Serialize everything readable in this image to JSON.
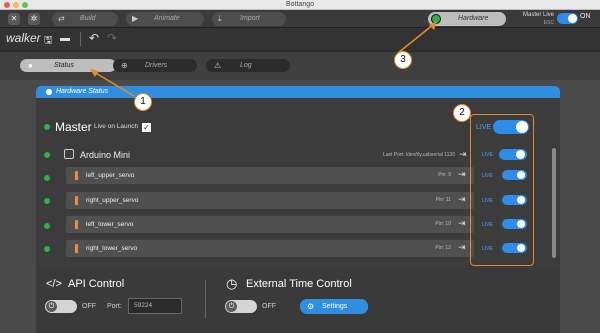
{
  "window": {
    "title": "Bottango"
  },
  "toolbar": {
    "build_label": "Build",
    "animate_label": "Animate",
    "import_label": "Import",
    "hardware_label": "Hardware",
    "master_live_label": "Master Live",
    "esc_hint": "ESC",
    "on_label": "ON"
  },
  "project": {
    "name": "walker"
  },
  "tabs": [
    {
      "label": "Status"
    },
    {
      "label": "Drivers"
    },
    {
      "label": "Log"
    }
  ],
  "panel": {
    "title": "Hardware Status",
    "master_label": "Master",
    "live_on_launch": "Live on Launch",
    "live_label": "LIVE",
    "driver": {
      "name": "Arduino Mini",
      "last_port": "Last Port: /dev/tty.usbserial 1130",
      "live_label": "LIVE"
    },
    "servos": [
      {
        "name": "left_upper_servo",
        "pin": "Pin: 9",
        "live": "LIVE"
      },
      {
        "name": "right_upper_servo",
        "pin": "Pin: 11",
        "live": "LIVE"
      },
      {
        "name": "left_lower_servo",
        "pin": "Pin: 10",
        "live": "LIVE"
      },
      {
        "name": "right_lower_servo",
        "pin": "Pin: 12",
        "live": "LIVE"
      }
    ]
  },
  "api_control": {
    "title": "API Control",
    "state": "OFF",
    "port_label": "Port:",
    "port_value": "59224"
  },
  "external_time": {
    "title": "External Time Control",
    "state": "OFF",
    "settings_label": "Settings"
  },
  "annotations": [
    "1",
    "2",
    "3"
  ],
  "colors": {
    "accent": "#2f8ee0",
    "live_green": "#2bb34a",
    "annotation": "#e38a2b",
    "servo": "#f08a3c"
  },
  "icons": [
    "close-icon",
    "settings-icon",
    "build-icon",
    "animate-icon",
    "import-icon",
    "save-icon",
    "folder-icon",
    "undo-icon",
    "redo-icon",
    "chip-icon",
    "port-icon",
    "servo-icon",
    "code-icon",
    "clock-icon",
    "power-icon",
    "gear-icon"
  ]
}
